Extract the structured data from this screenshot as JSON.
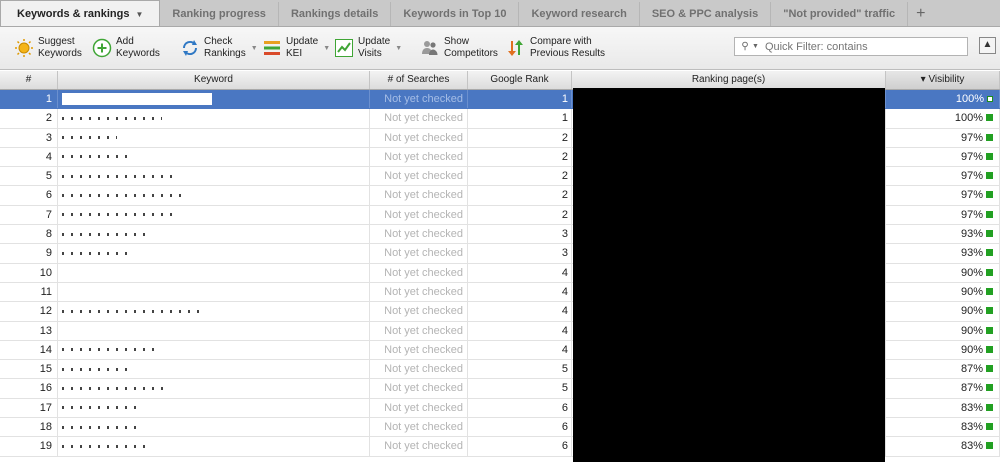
{
  "tabs": [
    {
      "label": "Keywords & rankings",
      "active": true
    },
    {
      "label": "Ranking progress"
    },
    {
      "label": "Rankings details"
    },
    {
      "label": "Keywords in Top 10"
    },
    {
      "label": "Keyword research"
    },
    {
      "label": "SEO & PPC analysis"
    },
    {
      "label": "\"Not provided\" traffic"
    }
  ],
  "toolbar": {
    "suggest": "Suggest\nKeywords",
    "add": "Add\nKeywords",
    "check": "Check\nRankings",
    "kei": "Update\nKEI",
    "visits": "Update\nVisits",
    "competitors": "Show\nCompetitors",
    "compare": "Compare with\nPrevious Results"
  },
  "filter": {
    "placeholder": "Quick Filter: contains"
  },
  "columns": {
    "num": "#",
    "keyword": "Keyword",
    "searches": "# of Searches",
    "rank": "Google Rank",
    "page": "Ranking page(s)",
    "visibility": "Visibility",
    "sort_arrow": "▾"
  },
  "colors": {
    "selected_row": "#4a77c2",
    "visibility_green": "#22a022"
  },
  "rows": [
    {
      "n": "1",
      "searches": "Not yet checked",
      "rank": "1",
      "vis": "100%"
    },
    {
      "n": "2",
      "searches": "Not yet checked",
      "rank": "1",
      "vis": "100%"
    },
    {
      "n": "3",
      "searches": "Not yet checked",
      "rank": "2",
      "vis": "97%"
    },
    {
      "n": "4",
      "searches": "Not yet checked",
      "rank": "2",
      "vis": "97%"
    },
    {
      "n": "5",
      "searches": "Not yet checked",
      "rank": "2",
      "vis": "97%"
    },
    {
      "n": "6",
      "searches": "Not yet checked",
      "rank": "2",
      "vis": "97%"
    },
    {
      "n": "7",
      "searches": "Not yet checked",
      "rank": "2",
      "vis": "97%"
    },
    {
      "n": "8",
      "searches": "Not yet checked",
      "rank": "3",
      "vis": "93%"
    },
    {
      "n": "9",
      "searches": "Not yet checked",
      "rank": "3",
      "vis": "93%"
    },
    {
      "n": "10",
      "searches": "Not yet checked",
      "rank": "4",
      "vis": "90%"
    },
    {
      "n": "11",
      "searches": "Not yet checked",
      "rank": "4",
      "vis": "90%"
    },
    {
      "n": "12",
      "searches": "Not yet checked",
      "rank": "4",
      "vis": "90%"
    },
    {
      "n": "13",
      "searches": "Not yet checked",
      "rank": "4",
      "vis": "90%"
    },
    {
      "n": "14",
      "searches": "Not yet checked",
      "rank": "4",
      "vis": "90%"
    },
    {
      "n": "15",
      "searches": "Not yet checked",
      "rank": "5",
      "vis": "87%"
    },
    {
      "n": "16",
      "searches": "Not yet checked",
      "rank": "5",
      "vis": "87%"
    },
    {
      "n": "17",
      "searches": "Not yet checked",
      "rank": "6",
      "vis": "83%"
    },
    {
      "n": "18",
      "searches": "Not yet checked",
      "rank": "6",
      "vis": "83%"
    },
    {
      "n": "19",
      "searches": "Not yet checked",
      "rank": "6",
      "vis": "83%"
    }
  ]
}
